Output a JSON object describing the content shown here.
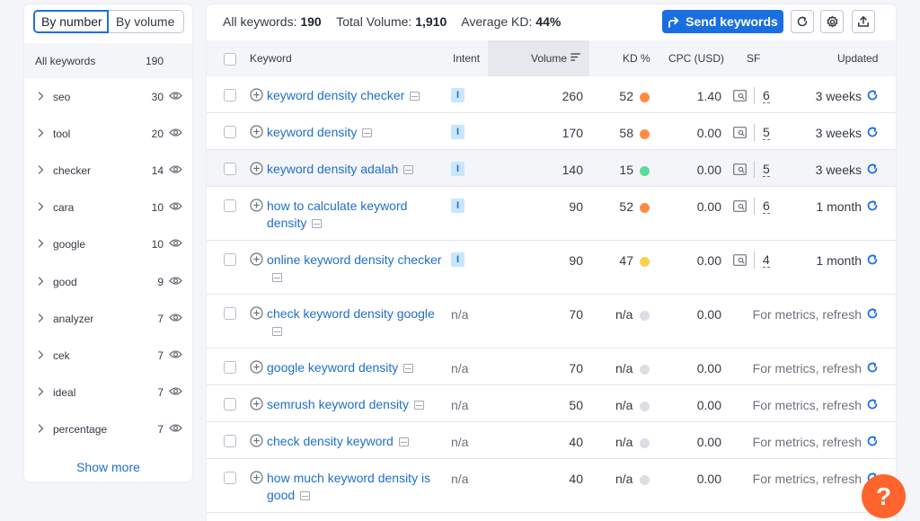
{
  "colors": {
    "accent": "#1a6fe0",
    "link": "#1f6fc9",
    "kd_orange": "#ff8c43",
    "kd_green": "#59dd9c",
    "kd_yellow": "#fcd053",
    "kd_gray": "#dcdee3",
    "help_orange": "#ff642d"
  },
  "left_panel": {
    "toggle_by_number": "By number",
    "toggle_by_volume": "By volume",
    "header_label": "All keywords",
    "header_count": "190",
    "groups": [
      {
        "name": "seo",
        "count": "30"
      },
      {
        "name": "tool",
        "count": "20"
      },
      {
        "name": "checker",
        "count": "14"
      },
      {
        "name": "cara",
        "count": "10"
      },
      {
        "name": "google",
        "count": "10"
      },
      {
        "name": "good",
        "count": "9"
      },
      {
        "name": "analyzer",
        "count": "7"
      },
      {
        "name": "cek",
        "count": "7"
      },
      {
        "name": "ideal",
        "count": "7"
      },
      {
        "name": "percentage",
        "count": "7"
      }
    ],
    "show_more": "Show more"
  },
  "summary": {
    "all_keywords_label": "All keywords:",
    "all_keywords_value": "190",
    "total_volume_label": "Total Volume:",
    "total_volume_value": "1,910",
    "avg_kd_label": "Average KD:",
    "avg_kd_value": "44%"
  },
  "toolbar": {
    "send_keywords": "Send keywords",
    "icons": [
      "refresh-icon",
      "gear-icon",
      "export-icon"
    ]
  },
  "table": {
    "columns": {
      "keyword": "Keyword",
      "intent": "Intent",
      "volume": "Volume",
      "kd": "KD %",
      "cpc": "CPC (USD)",
      "sf": "SF",
      "updated": "Updated"
    },
    "rows": [
      {
        "keyword": "keyword density checker",
        "intent": "I",
        "volume": "260",
        "kd": "52",
        "kd_color": "orange",
        "cpc": "1.40",
        "sf": "6",
        "updated": "3 weeks"
      },
      {
        "keyword": "keyword density",
        "intent": "I",
        "volume": "170",
        "kd": "58",
        "kd_color": "orange",
        "cpc": "0.00",
        "sf": "5",
        "updated": "3 weeks"
      },
      {
        "keyword": "keyword density adalah",
        "intent": "I",
        "volume": "140",
        "kd": "15",
        "kd_color": "green",
        "cpc": "0.00",
        "sf": "5",
        "updated": "3 weeks"
      },
      {
        "keyword": "how to calculate keyword density",
        "intent": "I",
        "volume": "90",
        "kd": "52",
        "kd_color": "orange",
        "cpc": "0.00",
        "sf": "6",
        "updated": "1 month"
      },
      {
        "keyword": "online keyword density checker",
        "intent": "I",
        "volume": "90",
        "kd": "47",
        "kd_color": "yellow",
        "cpc": "0.00",
        "sf": "4",
        "updated": "1 month"
      },
      {
        "keyword": "check keyword density google",
        "intent": "n/a",
        "volume": "70",
        "kd": "n/a",
        "kd_color": "gray",
        "cpc": "0.00",
        "sf": "",
        "updated": "For metrics, refresh"
      },
      {
        "keyword": "google keyword density",
        "intent": "n/a",
        "volume": "70",
        "kd": "n/a",
        "kd_color": "gray",
        "cpc": "0.00",
        "sf": "",
        "updated": "For metrics, refresh"
      },
      {
        "keyword": "semrush keyword density",
        "intent": "n/a",
        "volume": "50",
        "kd": "n/a",
        "kd_color": "gray",
        "cpc": "0.00",
        "sf": "",
        "updated": "For metrics, refresh"
      },
      {
        "keyword": "check density keyword",
        "intent": "n/a",
        "volume": "40",
        "kd": "n/a",
        "kd_color": "gray",
        "cpc": "0.00",
        "sf": "",
        "updated": "For metrics, refresh"
      },
      {
        "keyword": "how much keyword density is good",
        "intent": "n/a",
        "volume": "40",
        "kd": "n/a",
        "kd_color": "gray",
        "cpc": "0.00",
        "sf": "",
        "updated": "For metrics, refresh"
      }
    ]
  },
  "help_button": "?"
}
